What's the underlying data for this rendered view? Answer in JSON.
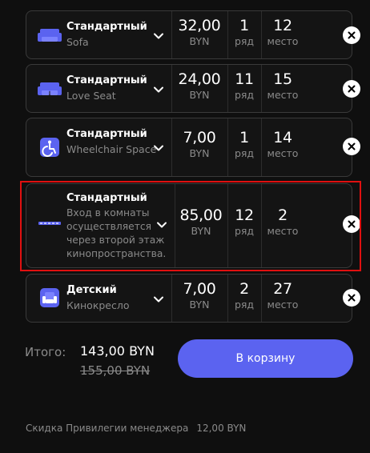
{
  "tickets": [
    {
      "title": "Стандартный",
      "subtitle": "Sofa",
      "icon": "sofa-icon",
      "price": "32,00",
      "currency": "BYN",
      "row": "1",
      "row_label": "ряд",
      "seat": "12",
      "seat_label": "место"
    },
    {
      "title": "Стандартный",
      "subtitle": "Love Seat",
      "icon": "love-seat-icon",
      "price": "24,00",
      "currency": "BYN",
      "row": "11",
      "row_label": "ряд",
      "seat": "15",
      "seat_label": "место"
    },
    {
      "title": "Стандартный",
      "subtitle": "Wheelchair Space",
      "icon": "wheelchair-icon",
      "price": "7,00",
      "currency": "BYN",
      "row": "1",
      "row_label": "ряд",
      "seat": "14",
      "seat_label": "место"
    },
    {
      "title": "Стандартный",
      "subtitle": "Вход в комнаты осуществляется через второй этаж кинопространства.",
      "icon": "room-icon",
      "price": "85,00",
      "currency": "BYN",
      "row": "12",
      "row_label": "ряд",
      "seat": "2",
      "seat_label": "место"
    },
    {
      "title": "Детский",
      "subtitle": "Кинокресло",
      "icon": "armchair-icon",
      "price": "7,00",
      "currency": "BYN",
      "row": "2",
      "row_label": "ряд",
      "seat": "27",
      "seat_label": "место"
    }
  ],
  "summary": {
    "total_label": "Итого:",
    "total_value": "143,00 BYN",
    "old_price": "155,00 BYN",
    "cart_button": "В корзину",
    "discount_label": "Скидка Привилегии менеджера",
    "discount_value": "12,00 BYN"
  },
  "colors": {
    "accent": "#5b63f0",
    "highlight": "#e01010",
    "background": "#0f0f0f"
  }
}
